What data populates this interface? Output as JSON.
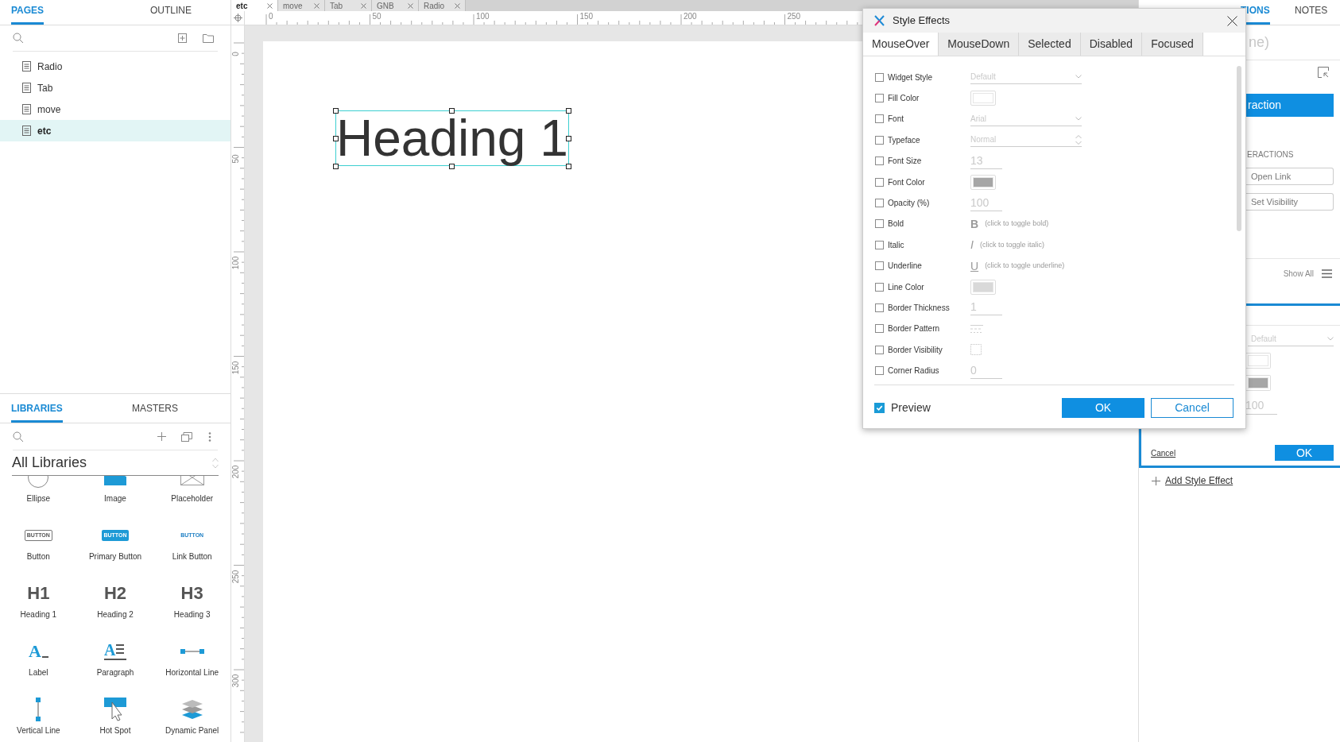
{
  "left_panel": {
    "tabs": [
      {
        "label": "PAGES",
        "selected": true
      },
      {
        "label": "OUTLINE",
        "selected": false
      }
    ],
    "pages": [
      {
        "name": "Radio",
        "selected": false
      },
      {
        "name": "Tab",
        "selected": false
      },
      {
        "name": "move",
        "selected": false
      },
      {
        "name": "etc",
        "selected": true
      }
    ]
  },
  "libraries_panel": {
    "tabs": [
      {
        "label": "LIBRARIES",
        "selected": true
      },
      {
        "label": "MASTERS",
        "selected": false
      }
    ],
    "library_select": "All Libraries",
    "widgets": [
      {
        "label": "Ellipse",
        "kind": "ellipse"
      },
      {
        "label": "Image",
        "kind": "image"
      },
      {
        "label": "Placeholder",
        "kind": "placeholder"
      },
      {
        "label": "Button",
        "kind": "button",
        "icon_text": "BUTTON"
      },
      {
        "label": "Primary Button",
        "kind": "primary",
        "icon_text": "BUTTON"
      },
      {
        "label": "Link Button",
        "kind": "link",
        "icon_text": "BUTTON"
      },
      {
        "label": "Heading 1",
        "kind": "heading",
        "icon_text": "H1"
      },
      {
        "label": "Heading 2",
        "kind": "heading",
        "icon_text": "H2"
      },
      {
        "label": "Heading 3",
        "kind": "heading",
        "icon_text": "H3"
      },
      {
        "label": "Label",
        "kind": "label",
        "icon_text": "A"
      },
      {
        "label": "Paragraph",
        "kind": "paragraph",
        "icon_text": "A"
      },
      {
        "label": "Horizontal Line",
        "kind": "hline"
      },
      {
        "label": "Vertical Line",
        "kind": "vline"
      },
      {
        "label": "Hot Spot",
        "kind": "hotspot"
      },
      {
        "label": "Dynamic Panel",
        "kind": "dynamic"
      }
    ]
  },
  "document_tabs": [
    {
      "label": "etc",
      "selected": true
    },
    {
      "label": "move",
      "selected": false
    },
    {
      "label": "Tab",
      "selected": false
    },
    {
      "label": "GNB",
      "selected": false
    },
    {
      "label": "Radio",
      "selected": false
    }
  ],
  "rulers": {
    "horizontal": [
      "0",
      "50",
      "100",
      "150",
      "200",
      "250"
    ],
    "vertical": [
      "0",
      "50",
      "100",
      "150",
      "200",
      "250",
      "300"
    ]
  },
  "canvas": {
    "widget_text": "Heading 1"
  },
  "right_panel": {
    "tabs": [
      {
        "label": "TIONS",
        "selected": true
      },
      {
        "label": "NOTES",
        "selected": false
      }
    ],
    "widget_name": "ne)",
    "new_interaction_button": "raction",
    "section_label": "ERACTIONS",
    "interaction_buttons": [
      "Open Link",
      "Set Visibility"
    ],
    "show_all": "Show All",
    "style_select": "Default",
    "swatches": [
      {
        "color": "#ffffff"
      },
      {
        "color": "#a6a6a6"
      }
    ],
    "opacity": "100",
    "cancel_link": "Cancel",
    "ok_button": "OK",
    "add_style_effect": "Add Style Effect"
  },
  "dialog": {
    "title": "Style Effects",
    "tabs": [
      {
        "label": "MouseOver",
        "selected": true
      },
      {
        "label": "MouseDown",
        "selected": false
      },
      {
        "label": "Selected",
        "selected": false
      },
      {
        "label": "Disabled",
        "selected": false
      },
      {
        "label": "Focused",
        "selected": false
      }
    ],
    "rows": [
      {
        "label": "Widget Style",
        "checked": false,
        "kind": "select",
        "value": "Default"
      },
      {
        "label": "Fill Color",
        "checked": false,
        "kind": "color",
        "color": "#ffffff"
      },
      {
        "label": "Font",
        "checked": false,
        "kind": "select",
        "value": "Arial"
      },
      {
        "label": "Typeface",
        "checked": false,
        "kind": "spinner",
        "value": "Normal"
      },
      {
        "label": "Font Size",
        "checked": false,
        "kind": "number",
        "value": "13"
      },
      {
        "label": "Font Color",
        "checked": false,
        "kind": "color",
        "color": "#a6a6a6"
      },
      {
        "label": "Opacity (%)",
        "checked": false,
        "kind": "number",
        "value": "100"
      },
      {
        "label": "Bold",
        "checked": false,
        "kind": "toggle",
        "glyph": "B",
        "hint": "(click to toggle bold)"
      },
      {
        "label": "Italic",
        "checked": false,
        "kind": "toggle",
        "glyph": "I",
        "hint": "(click to toggle italic)"
      },
      {
        "label": "Underline",
        "checked": false,
        "kind": "toggle",
        "glyph": "U",
        "hint": "(click to toggle underline)"
      },
      {
        "label": "Line Color",
        "checked": false,
        "kind": "color",
        "color": "#d9d9d9"
      },
      {
        "label": "Border Thickness",
        "checked": false,
        "kind": "number",
        "value": "1"
      },
      {
        "label": "Border Pattern",
        "checked": false,
        "kind": "pattern"
      },
      {
        "label": "Border Visibility",
        "checked": false,
        "kind": "visibility"
      },
      {
        "label": "Corner Radius",
        "checked": false,
        "kind": "number",
        "value": "0"
      }
    ],
    "preview": {
      "label": "Preview",
      "checked": true
    },
    "ok_button": "OK",
    "cancel_button": "Cancel"
  }
}
